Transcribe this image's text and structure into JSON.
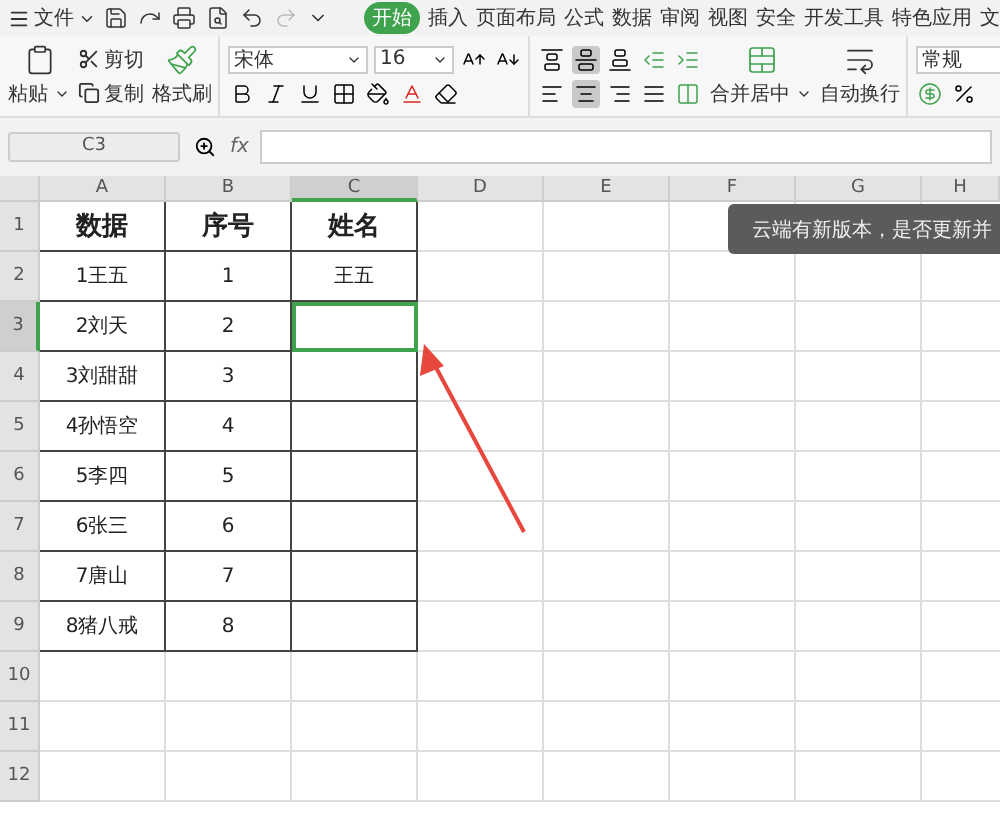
{
  "menu": {
    "file": "文件"
  },
  "tabs": [
    {
      "label": "开始",
      "selected": true
    },
    {
      "label": "插入",
      "selected": false
    },
    {
      "label": "页面布局",
      "selected": false
    },
    {
      "label": "公式",
      "selected": false
    },
    {
      "label": "数据",
      "selected": false
    },
    {
      "label": "审阅",
      "selected": false
    },
    {
      "label": "视图",
      "selected": false
    },
    {
      "label": "安全",
      "selected": false
    },
    {
      "label": "开发工具",
      "selected": false
    },
    {
      "label": "特色应用",
      "selected": false
    },
    {
      "label": "文",
      "selected": false
    }
  ],
  "ribbon": {
    "paste": "粘贴",
    "cut": "剪切",
    "copy": "复制",
    "format_painter": "格式刷",
    "font": "宋体",
    "font_size": "16",
    "merge": "合并居中",
    "wrap": "自动换行",
    "number_format": "常规"
  },
  "formula_bar": {
    "name_box": "C3",
    "fx": "fx"
  },
  "table": {
    "columns": [
      {
        "label": "A",
        "selected": false
      },
      {
        "label": "B",
        "selected": false
      },
      {
        "label": "C",
        "selected": true
      },
      {
        "label": "D",
        "selected": false
      },
      {
        "label": "E",
        "selected": false
      },
      {
        "label": "F",
        "selected": false
      },
      {
        "label": "G",
        "selected": false
      },
      {
        "label": "H",
        "selected": false
      }
    ],
    "rows": [
      {
        "number": "1",
        "kind": "heading",
        "selected": false,
        "cells": [
          {
            "text": "数据",
            "selected": false
          },
          {
            "text": "序号",
            "selected": false
          },
          {
            "text": "姓名",
            "selected": false
          }
        ]
      },
      {
        "number": "2",
        "kind": "data",
        "selected": false,
        "cells": [
          {
            "text": "1王五",
            "selected": false
          },
          {
            "text": "1",
            "selected": false
          },
          {
            "text": "王五",
            "selected": false
          }
        ]
      },
      {
        "number": "3",
        "kind": "data",
        "selected": true,
        "cells": [
          {
            "text": "2刘天",
            "selected": false
          },
          {
            "text": "2",
            "selected": false
          },
          {
            "selected": true
          }
        ]
      },
      {
        "number": "4",
        "kind": "data",
        "selected": false,
        "cells": [
          {
            "text": "3刘甜甜",
            "selected": false
          },
          {
            "text": "3",
            "selected": false
          },
          {
            "selected": false
          }
        ]
      },
      {
        "number": "5",
        "kind": "data",
        "selected": false,
        "cells": [
          {
            "text": "4孙悟空",
            "selected": false
          },
          {
            "text": "4",
            "selected": false
          },
          {
            "selected": false
          }
        ]
      },
      {
        "number": "6",
        "kind": "data",
        "selected": false,
        "cells": [
          {
            "text": "5李四",
            "selected": false
          },
          {
            "text": "5",
            "selected": false
          },
          {
            "selected": false
          }
        ]
      },
      {
        "number": "7",
        "kind": "data",
        "selected": false,
        "cells": [
          {
            "text": "6张三",
            "selected": false
          },
          {
            "text": "6",
            "selected": false
          },
          {
            "selected": false
          }
        ]
      },
      {
        "number": "8",
        "kind": "data",
        "selected": false,
        "cells": [
          {
            "text": "7唐山",
            "selected": false
          },
          {
            "text": "7",
            "selected": false
          },
          {
            "selected": false
          }
        ]
      },
      {
        "number": "9",
        "kind": "data",
        "selected": false,
        "cells": [
          {
            "text": "8猪八戒",
            "selected": false
          },
          {
            "text": "8",
            "selected": false
          },
          {
            "selected": false
          }
        ]
      },
      {
        "number": "10",
        "kind": "empty",
        "selected": false
      },
      {
        "number": "11",
        "kind": "empty",
        "selected": false
      },
      {
        "number": "12",
        "kind": "empty",
        "selected": false
      }
    ]
  },
  "toast": {
    "text": "云端有新版本，是否更新并"
  }
}
